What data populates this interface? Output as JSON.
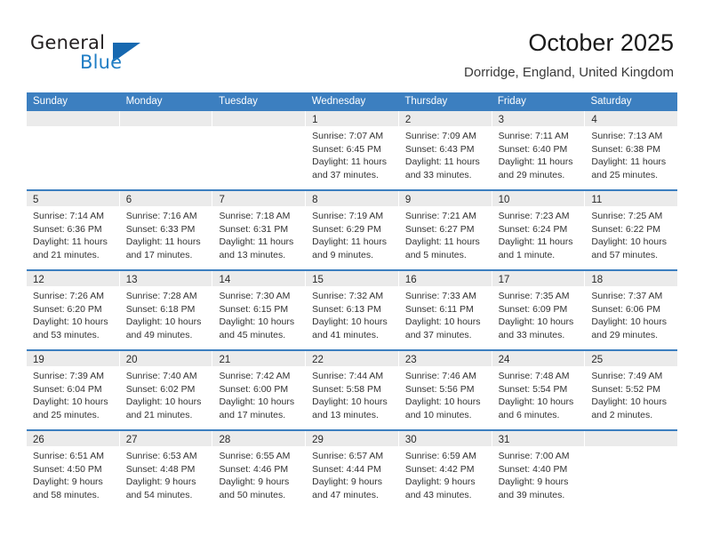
{
  "logo": {
    "word_primary": "General",
    "word_secondary": "Blue",
    "triangle_color": "#1668b0"
  },
  "header": {
    "title": "October 2025",
    "subtitle": "Dorridge, England, United Kingdom"
  },
  "colors": {
    "header_blue": "#3c7fc0",
    "day_band_gray": "#ebebeb",
    "text": "#333333"
  },
  "weekdays": [
    "Sunday",
    "Monday",
    "Tuesday",
    "Wednesday",
    "Thursday",
    "Friday",
    "Saturday"
  ],
  "weeks": [
    [
      {
        "empty": true
      },
      {
        "empty": true
      },
      {
        "empty": true
      },
      {
        "day": "1",
        "sunrise": "Sunrise: 7:07 AM",
        "sunset": "Sunset: 6:45 PM",
        "daylight1": "Daylight: 11 hours",
        "daylight2": "and 37 minutes."
      },
      {
        "day": "2",
        "sunrise": "Sunrise: 7:09 AM",
        "sunset": "Sunset: 6:43 PM",
        "daylight1": "Daylight: 11 hours",
        "daylight2": "and 33 minutes."
      },
      {
        "day": "3",
        "sunrise": "Sunrise: 7:11 AM",
        "sunset": "Sunset: 6:40 PM",
        "daylight1": "Daylight: 11 hours",
        "daylight2": "and 29 minutes."
      },
      {
        "day": "4",
        "sunrise": "Sunrise: 7:13 AM",
        "sunset": "Sunset: 6:38 PM",
        "daylight1": "Daylight: 11 hours",
        "daylight2": "and 25 minutes."
      }
    ],
    [
      {
        "day": "5",
        "sunrise": "Sunrise: 7:14 AM",
        "sunset": "Sunset: 6:36 PM",
        "daylight1": "Daylight: 11 hours",
        "daylight2": "and 21 minutes."
      },
      {
        "day": "6",
        "sunrise": "Sunrise: 7:16 AM",
        "sunset": "Sunset: 6:33 PM",
        "daylight1": "Daylight: 11 hours",
        "daylight2": "and 17 minutes."
      },
      {
        "day": "7",
        "sunrise": "Sunrise: 7:18 AM",
        "sunset": "Sunset: 6:31 PM",
        "daylight1": "Daylight: 11 hours",
        "daylight2": "and 13 minutes."
      },
      {
        "day": "8",
        "sunrise": "Sunrise: 7:19 AM",
        "sunset": "Sunset: 6:29 PM",
        "daylight1": "Daylight: 11 hours",
        "daylight2": "and 9 minutes."
      },
      {
        "day": "9",
        "sunrise": "Sunrise: 7:21 AM",
        "sunset": "Sunset: 6:27 PM",
        "daylight1": "Daylight: 11 hours",
        "daylight2": "and 5 minutes."
      },
      {
        "day": "10",
        "sunrise": "Sunrise: 7:23 AM",
        "sunset": "Sunset: 6:24 PM",
        "daylight1": "Daylight: 11 hours",
        "daylight2": "and 1 minute."
      },
      {
        "day": "11",
        "sunrise": "Sunrise: 7:25 AM",
        "sunset": "Sunset: 6:22 PM",
        "daylight1": "Daylight: 10 hours",
        "daylight2": "and 57 minutes."
      }
    ],
    [
      {
        "day": "12",
        "sunrise": "Sunrise: 7:26 AM",
        "sunset": "Sunset: 6:20 PM",
        "daylight1": "Daylight: 10 hours",
        "daylight2": "and 53 minutes."
      },
      {
        "day": "13",
        "sunrise": "Sunrise: 7:28 AM",
        "sunset": "Sunset: 6:18 PM",
        "daylight1": "Daylight: 10 hours",
        "daylight2": "and 49 minutes."
      },
      {
        "day": "14",
        "sunrise": "Sunrise: 7:30 AM",
        "sunset": "Sunset: 6:15 PM",
        "daylight1": "Daylight: 10 hours",
        "daylight2": "and 45 minutes."
      },
      {
        "day": "15",
        "sunrise": "Sunrise: 7:32 AM",
        "sunset": "Sunset: 6:13 PM",
        "daylight1": "Daylight: 10 hours",
        "daylight2": "and 41 minutes."
      },
      {
        "day": "16",
        "sunrise": "Sunrise: 7:33 AM",
        "sunset": "Sunset: 6:11 PM",
        "daylight1": "Daylight: 10 hours",
        "daylight2": "and 37 minutes."
      },
      {
        "day": "17",
        "sunrise": "Sunrise: 7:35 AM",
        "sunset": "Sunset: 6:09 PM",
        "daylight1": "Daylight: 10 hours",
        "daylight2": "and 33 minutes."
      },
      {
        "day": "18",
        "sunrise": "Sunrise: 7:37 AM",
        "sunset": "Sunset: 6:06 PM",
        "daylight1": "Daylight: 10 hours",
        "daylight2": "and 29 minutes."
      }
    ],
    [
      {
        "day": "19",
        "sunrise": "Sunrise: 7:39 AM",
        "sunset": "Sunset: 6:04 PM",
        "daylight1": "Daylight: 10 hours",
        "daylight2": "and 25 minutes."
      },
      {
        "day": "20",
        "sunrise": "Sunrise: 7:40 AM",
        "sunset": "Sunset: 6:02 PM",
        "daylight1": "Daylight: 10 hours",
        "daylight2": "and 21 minutes."
      },
      {
        "day": "21",
        "sunrise": "Sunrise: 7:42 AM",
        "sunset": "Sunset: 6:00 PM",
        "daylight1": "Daylight: 10 hours",
        "daylight2": "and 17 minutes."
      },
      {
        "day": "22",
        "sunrise": "Sunrise: 7:44 AM",
        "sunset": "Sunset: 5:58 PM",
        "daylight1": "Daylight: 10 hours",
        "daylight2": "and 13 minutes."
      },
      {
        "day": "23",
        "sunrise": "Sunrise: 7:46 AM",
        "sunset": "Sunset: 5:56 PM",
        "daylight1": "Daylight: 10 hours",
        "daylight2": "and 10 minutes."
      },
      {
        "day": "24",
        "sunrise": "Sunrise: 7:48 AM",
        "sunset": "Sunset: 5:54 PM",
        "daylight1": "Daylight: 10 hours",
        "daylight2": "and 6 minutes."
      },
      {
        "day": "25",
        "sunrise": "Sunrise: 7:49 AM",
        "sunset": "Sunset: 5:52 PM",
        "daylight1": "Daylight: 10 hours",
        "daylight2": "and 2 minutes."
      }
    ],
    [
      {
        "day": "26",
        "sunrise": "Sunrise: 6:51 AM",
        "sunset": "Sunset: 4:50 PM",
        "daylight1": "Daylight: 9 hours",
        "daylight2": "and 58 minutes."
      },
      {
        "day": "27",
        "sunrise": "Sunrise: 6:53 AM",
        "sunset": "Sunset: 4:48 PM",
        "daylight1": "Daylight: 9 hours",
        "daylight2": "and 54 minutes."
      },
      {
        "day": "28",
        "sunrise": "Sunrise: 6:55 AM",
        "sunset": "Sunset: 4:46 PM",
        "daylight1": "Daylight: 9 hours",
        "daylight2": "and 50 minutes."
      },
      {
        "day": "29",
        "sunrise": "Sunrise: 6:57 AM",
        "sunset": "Sunset: 4:44 PM",
        "daylight1": "Daylight: 9 hours",
        "daylight2": "and 47 minutes."
      },
      {
        "day": "30",
        "sunrise": "Sunrise: 6:59 AM",
        "sunset": "Sunset: 4:42 PM",
        "daylight1": "Daylight: 9 hours",
        "daylight2": "and 43 minutes."
      },
      {
        "day": "31",
        "sunrise": "Sunrise: 7:00 AM",
        "sunset": "Sunset: 4:40 PM",
        "daylight1": "Daylight: 9 hours",
        "daylight2": "and 39 minutes."
      },
      {
        "empty": true
      }
    ]
  ]
}
